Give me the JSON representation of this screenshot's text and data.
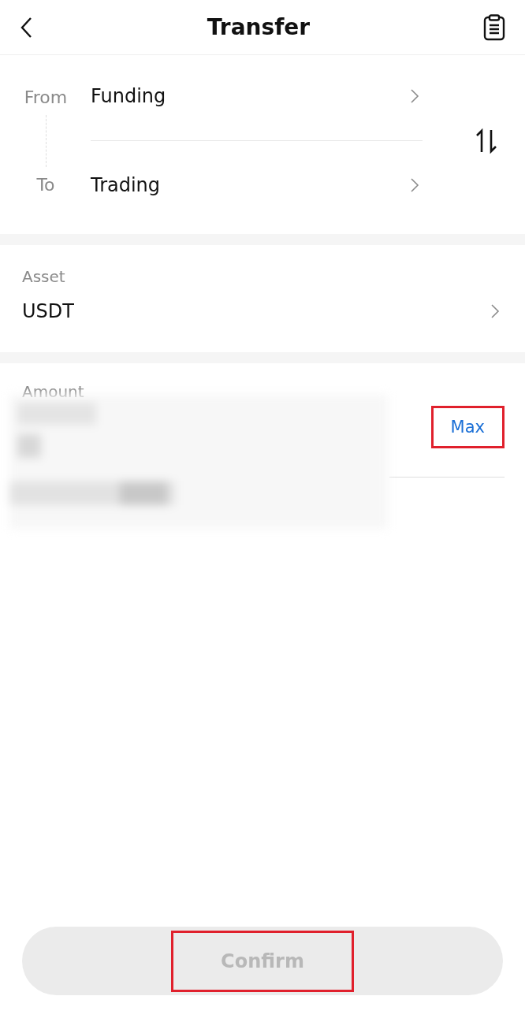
{
  "header": {
    "title": "Transfer"
  },
  "route": {
    "from": {
      "label": "From",
      "value": "Funding"
    },
    "to": {
      "label": "To",
      "value": "Trading"
    }
  },
  "asset": {
    "label": "Asset",
    "value": "USDT"
  },
  "amount": {
    "label": "Amount",
    "max": {
      "label": "Max",
      "highlighted": true
    }
  },
  "confirm": {
    "label": "Confirm",
    "disabled": true,
    "highlighted": true
  }
}
